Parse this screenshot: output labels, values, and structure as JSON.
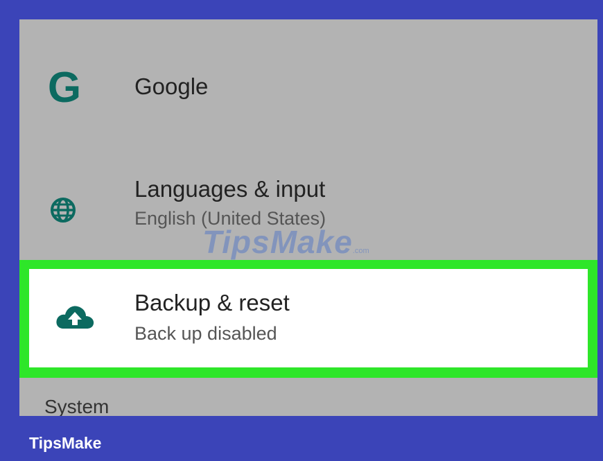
{
  "settings": {
    "items": [
      {
        "title": "Google",
        "icon": "google-g-icon"
      },
      {
        "title": "Languages & input",
        "subtitle": "English (United States)",
        "icon": "globe-icon"
      },
      {
        "title": "Backup & reset",
        "subtitle": "Back up disabled",
        "icon": "cloud-upload-icon",
        "highlighted": true
      }
    ],
    "section_header": "System"
  },
  "icons": {
    "google_glyph": "G"
  },
  "watermark": {
    "text": "TipsMake",
    "suffix": ".com"
  },
  "footer": {
    "brand": "TipsMake"
  },
  "colors": {
    "icon_teal": "#0c6a60",
    "highlight_green": "#2ee629",
    "frame_blue": "#3b44b8",
    "screen_gray": "#b3b3b3"
  }
}
